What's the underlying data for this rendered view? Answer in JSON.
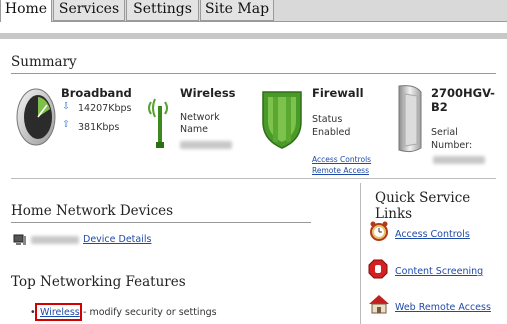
{
  "tabs": [
    {
      "label": "Home",
      "active": true
    },
    {
      "label": "Services",
      "active": false
    },
    {
      "label": "Settings",
      "active": false
    },
    {
      "label": "Site Map",
      "active": false
    }
  ],
  "summary": {
    "title": "Summary",
    "broadband": {
      "title": "Broadband",
      "download": "14207Kbps",
      "upload": "381Kbps"
    },
    "wireless": {
      "title": "Wireless",
      "network_name_label_1": "Network",
      "network_name_label_2": "Name"
    },
    "firewall": {
      "title": "Firewall",
      "status_label": "Status",
      "status_value": "Enabled",
      "link_access_controls": "Access Controls",
      "link_remote_access": "Remote Access"
    },
    "device": {
      "title_1": "2700HGV-",
      "title_2": "B2",
      "serial_label_1": "Serial",
      "serial_label_2": "Number:"
    }
  },
  "home_network": {
    "title": "Home Network Devices",
    "device_details_link": "Device Details"
  },
  "top_features": {
    "title": "Top Networking Features",
    "item_link": "Wireless",
    "item_text": "- modify security or settings"
  },
  "quick_links": {
    "title": "Quick Service Links",
    "items": [
      {
        "label": "Access Controls",
        "icon": "alarm-clock-icon"
      },
      {
        "label": "Content Screening",
        "icon": "stop-hand-icon"
      },
      {
        "label": "Web Remote Access",
        "icon": "house-icon"
      }
    ]
  },
  "colors": {
    "link": "#1f4aa8",
    "highlight": "#d40000",
    "firewall_green": "#4a9a2a"
  }
}
